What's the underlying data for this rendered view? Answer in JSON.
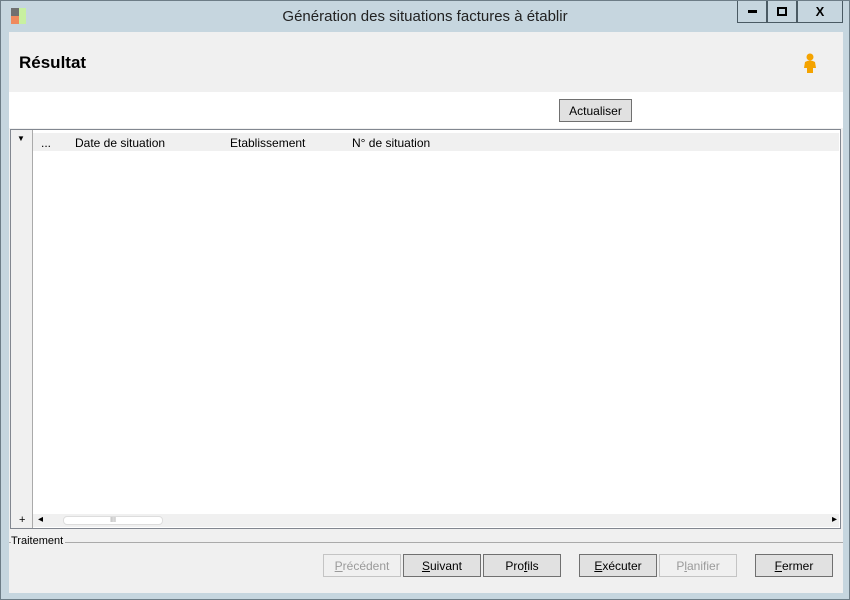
{
  "window": {
    "title": "Génération des situations factures à établir",
    "minimize": "▬",
    "maximize": "□",
    "close": "X"
  },
  "header": {
    "title": "Résultat",
    "user_icon": "person-icon"
  },
  "toolbar": {
    "refresh": "Actualiser"
  },
  "grid": {
    "expander": "▼",
    "columns": [
      "...",
      "Date de situation",
      "Etablissement",
      "N° de situation"
    ],
    "rows": [],
    "add": "+",
    "scroll_left": "◂",
    "scroll_right": "▸",
    "thumb": "III"
  },
  "footer": {
    "group_label": "Traitement",
    "buttons": {
      "previous": {
        "pre": "",
        "key": "P",
        "post": "récédent"
      },
      "next": {
        "pre": "",
        "key": "S",
        "post": "uivant"
      },
      "profiles": {
        "pre": "Pro",
        "key": "f",
        "post": "ils"
      },
      "execute": {
        "pre": "",
        "key": "E",
        "post": "xécuter"
      },
      "schedule": {
        "pre": "P",
        "key": "l",
        "post": "anifier"
      },
      "close": {
        "pre": "",
        "key": "F",
        "post": "ermer"
      }
    }
  }
}
